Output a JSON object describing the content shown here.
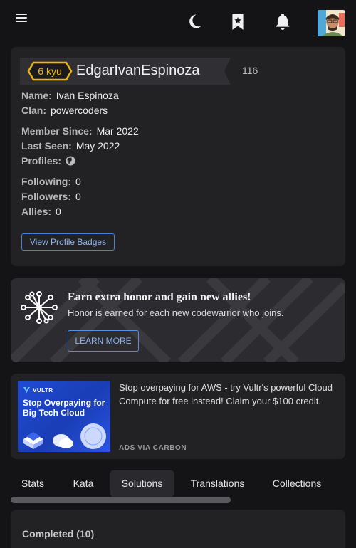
{
  "header": {
    "menu_icon": "hamburger-icon",
    "theme_icon": "moon-icon",
    "bookmarks_icon": "bookmark-star-icon",
    "notifications_icon": "bell-icon",
    "avatar_icon": "user-avatar"
  },
  "profile": {
    "rank": "6 kyu",
    "rank_color": "#ecb613",
    "username": "EdgarIvanEspinoza",
    "honor": "116",
    "name_label": "Name:",
    "name_value": "Ivan Espinoza",
    "clan_label": "Clan:",
    "clan_value": "powercoders",
    "member_since_label": "Member Since:",
    "member_since_value": "Mar 2022",
    "last_seen_label": "Last Seen:",
    "last_seen_value": "May 2022",
    "profiles_label": "Profiles:",
    "profiles_icon": "github-icon",
    "following_label": "Following:",
    "following_value": "0",
    "followers_label": "Followers:",
    "followers_value": "0",
    "allies_label": "Allies:",
    "allies_value": "0",
    "badges_button": "View Profile Badges"
  },
  "honor_banner": {
    "icon": "network-icon",
    "title": "Earn extra honor and gain new allies!",
    "subtitle": "Honor is earned for each new codewarrior who joins.",
    "button": "LEARN MORE"
  },
  "ad": {
    "logo_text": "VULTR",
    "headline": "Stop Overpaying for Big Tech Cloud",
    "text": "Stop overpaying for AWS - try Vultr's powerful Cloud Compute for free instead! Claim your $100 credit.",
    "via": "ADS VIA CARBON"
  },
  "tabs": [
    {
      "label": "Stats"
    },
    {
      "label": "Kata"
    },
    {
      "label": "Solutions",
      "active": true
    },
    {
      "label": "Translations"
    },
    {
      "label": "Collections"
    }
  ],
  "completed": {
    "title": "Completed (10)"
  },
  "colors": {
    "background": "#141416",
    "card": "#222225",
    "accent_blue": "#4a7fd6"
  }
}
